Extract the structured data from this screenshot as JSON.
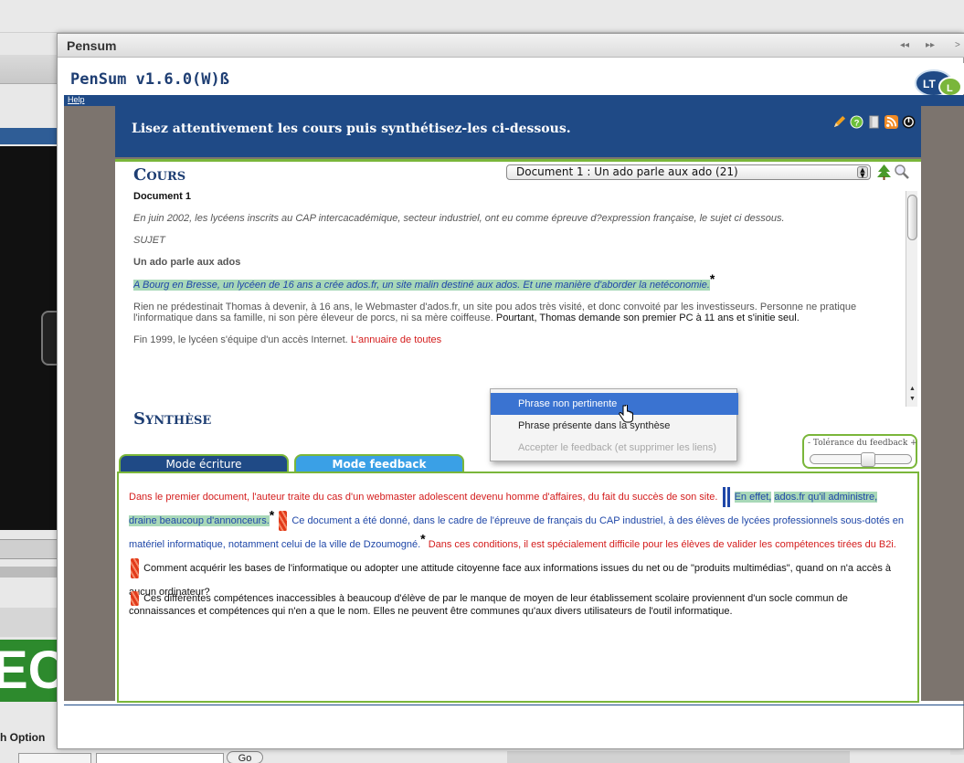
{
  "background": {
    "ect_text": "EC",
    "options_label": "h Option",
    "go_label": "Go"
  },
  "window": {
    "title": "Pensum",
    "nav_back": "◂◂",
    "nav_fwd": "▸▸",
    "nav_close": ">"
  },
  "app": {
    "title": "PenSum v1.6.0(W)ß",
    "help_link": "Help",
    "instruction": "Lisez attentivement les cours puis synthétisez-les ci-dessous."
  },
  "cours": {
    "heading": "Cours",
    "document_select": "Document 1 : Un ado parle aux ado (21)",
    "doc_label": "Document 1",
    "intro": "En juin 2002, les lycéens inscrits au CAP intercacadémique, secteur industriel, ont eu comme épreuve d?expression française, le sujet ci dessous.",
    "sujet": "SUJET",
    "subtitle": "Un ado parle aux ados",
    "highlight": "A Bourg en Bresse, un lycéen de 16 ans a crée ados.fr, un site malin destiné aux ados. Et une manière d'aborder la netéconomie.",
    "para_gray": "Rien ne prédestinait Thomas à devenir, à 16 ans, le Webmaster d'ados.fr, un site pou ados très visité, et donc convoité par les investisseurs. Personne ne pratique l'informatique dans sa famille, ni son père éleveur de porcs, ni sa mère coiffeuse.",
    "para_black": "Pourtant, Thomas demande son premier PC à 11 ans et s'initie seul.",
    "last_gray": "Fin 1999, le lycéen s'équipe d'un accès Internet.",
    "last_red": "L'annuaire de toutes"
  },
  "synthese": {
    "heading": "Synthèse",
    "tab_write": "Mode écriture",
    "tab_feedback": "Mode feedback",
    "tolerance_label": "- Tolérance du feedback +",
    "s1_red": "Dans le premier document, l'auteur traite du cas d'un webmaster adolescent devenu homme d'affaires, du fait du succès de son site.",
    "s2_hl_a": "En effet,",
    "s2_hl_b": "ados.fr qu'il administre, draine beaucoup d'annonceurs.",
    "s3_blue": "Ce document a été donné, dans le cadre de l'épreuve de français du CAP industriel, à des élèves de lycées professionnels sous-dotés en matériel informatique, notamment celui de la ville de Dzoumogné.",
    "s4_red": "Dans ces conditions, il est spécialement difficile pour les élèves de valider les compétences tirées du B2i.",
    "s5_black": "Comment acquérir les bases de l'informatique ou adopter une attitude citoyenne face aux informations issues du net ou de \"produits multimédias\", quand on n'a accès à aucun ordinateur?",
    "s6_black": "Ces différentes compétences inaccessibles à beaucoup d'élève de par le manque de moyen de leur établissement scolaire proviennent d'un socle commun de connaissances et compétences qui n'en a que le nom. Elles ne peuvent être communes qu'aux divers utilisateurs de l'outil informatique.",
    "star": "*"
  },
  "context_menu": {
    "item1": "Phrase non pertinente",
    "item2": "Phrase présente dans la synthèse",
    "item3": "Accepter le feedback (et supprimer les liens)"
  }
}
